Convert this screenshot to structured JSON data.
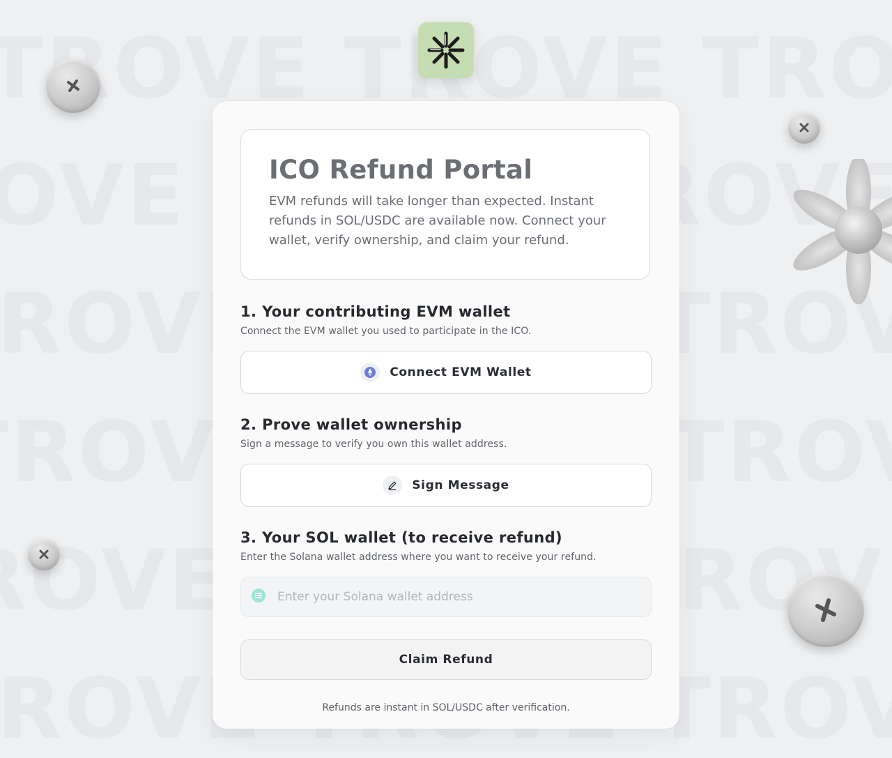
{
  "background": {
    "watermark_text": "TROVE TROVE TROVE TROVE",
    "color": "#eef0f2"
  },
  "logo": {
    "icon": "starburst-logo-icon",
    "bg_color": "#c6dcb2"
  },
  "intro": {
    "title": "ICO Refund Portal",
    "description": "EVM refunds will take longer than expected. Instant refunds in SOL/USDC are available now. Connect your wallet, verify ownership, and claim your refund."
  },
  "steps": {
    "evm": {
      "title": "1. Your contributing EVM wallet",
      "subtitle": "Connect the EVM wallet you used to participate in the ICO.",
      "button_label": "Connect EVM Wallet",
      "button_icon": "ethereum-icon"
    },
    "sign": {
      "title": "2. Prove wallet ownership",
      "subtitle": "Sign a message to verify you own this wallet address.",
      "button_label": "Sign Message",
      "button_icon": "pencil-icon"
    },
    "sol": {
      "title": "3. Your SOL wallet (to receive refund)",
      "subtitle": "Enter the Solana wallet address where you want to receive your refund.",
      "input_value": "",
      "input_placeholder": "Enter your Solana wallet address",
      "input_icon": "solana-icon"
    }
  },
  "claim": {
    "label": "Claim Refund"
  },
  "footer": {
    "note": "Refunds are instant in SOL/USDC after verification."
  },
  "colors": {
    "ethereum": "#6b7fd8",
    "solana": "#8fe0d1"
  }
}
